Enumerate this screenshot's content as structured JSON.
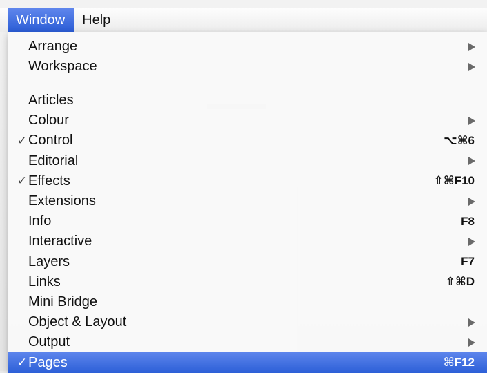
{
  "menubar": {
    "items": [
      {
        "label": "Window",
        "active": true
      },
      {
        "label": "Help",
        "active": false
      }
    ]
  },
  "menu": {
    "group1": [
      {
        "label": "Arrange",
        "submenu": true
      },
      {
        "label": "Workspace",
        "submenu": true
      }
    ],
    "group2": [
      {
        "label": "Articles",
        "checked": false,
        "submenu": false,
        "shortcut": ""
      },
      {
        "label": "Colour",
        "checked": false,
        "submenu": true,
        "shortcut": ""
      },
      {
        "label": "Control",
        "checked": true,
        "submenu": false,
        "shortcut": "⌥⌘6"
      },
      {
        "label": "Editorial",
        "checked": false,
        "submenu": true,
        "shortcut": ""
      },
      {
        "label": "Effects",
        "checked": true,
        "submenu": false,
        "shortcut": "⇧⌘F10"
      },
      {
        "label": "Extensions",
        "checked": false,
        "submenu": true,
        "shortcut": ""
      },
      {
        "label": "Info",
        "checked": false,
        "submenu": false,
        "shortcut": "F8"
      },
      {
        "label": "Interactive",
        "checked": false,
        "submenu": true,
        "shortcut": ""
      },
      {
        "label": "Layers",
        "checked": false,
        "submenu": false,
        "shortcut": "F7"
      },
      {
        "label": "Links",
        "checked": false,
        "submenu": false,
        "shortcut": "⇧⌘D"
      },
      {
        "label": "Mini Bridge",
        "checked": false,
        "submenu": false,
        "shortcut": ""
      },
      {
        "label": "Object & Layout",
        "checked": false,
        "submenu": true,
        "shortcut": ""
      },
      {
        "label": "Output",
        "checked": false,
        "submenu": true,
        "shortcut": ""
      },
      {
        "label": "Pages",
        "checked": true,
        "submenu": false,
        "shortcut": "⌘F12",
        "highlighted": true
      }
    ]
  },
  "icons": {
    "check": "✓",
    "submenu": "triangle-right-icon"
  },
  "colors": {
    "highlight": "#2c5fd7",
    "menubar": "#ececec",
    "menu_bg": "#fafafa"
  }
}
